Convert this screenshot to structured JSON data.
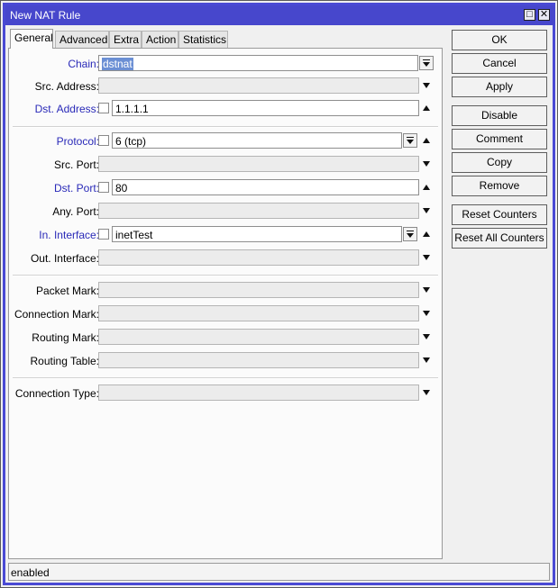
{
  "window": {
    "title": "New NAT Rule"
  },
  "tabs": [
    "General",
    "Advanced",
    "Extra",
    "Action",
    "Statistics"
  ],
  "fields": {
    "chain": {
      "label": "Chain:",
      "value": "dstnat"
    },
    "src_address": {
      "label": "Src. Address:",
      "value": ""
    },
    "dst_address": {
      "label": "Dst. Address:",
      "value": "1.1.1.1"
    },
    "protocol": {
      "label": "Protocol:",
      "value": "6 (tcp)"
    },
    "src_port": {
      "label": "Src. Port:",
      "value": ""
    },
    "dst_port": {
      "label": "Dst. Port:",
      "value": "80"
    },
    "any_port": {
      "label": "Any. Port:",
      "value": ""
    },
    "in_interface": {
      "label": "In. Interface:",
      "value": "inetTest"
    },
    "out_interface": {
      "label": "Out. Interface:",
      "value": ""
    },
    "packet_mark": {
      "label": "Packet Mark:",
      "value": ""
    },
    "connection_mark": {
      "label": "Connection Mark:",
      "value": ""
    },
    "routing_mark": {
      "label": "Routing Mark:",
      "value": ""
    },
    "routing_table": {
      "label": "Routing Table:",
      "value": ""
    },
    "connection_type": {
      "label": "Connection Type:",
      "value": ""
    }
  },
  "buttons": {
    "ok": "OK",
    "cancel": "Cancel",
    "apply": "Apply",
    "disable": "Disable",
    "comment": "Comment",
    "copy": "Copy",
    "remove": "Remove",
    "reset_counters": "Reset Counters",
    "reset_all_counters": "Reset All Counters"
  },
  "status": {
    "text": "enabled"
  },
  "colors": {
    "titlebar": "#4747cc",
    "label_active": "#2929b8",
    "selection": "#6b8fd4"
  }
}
